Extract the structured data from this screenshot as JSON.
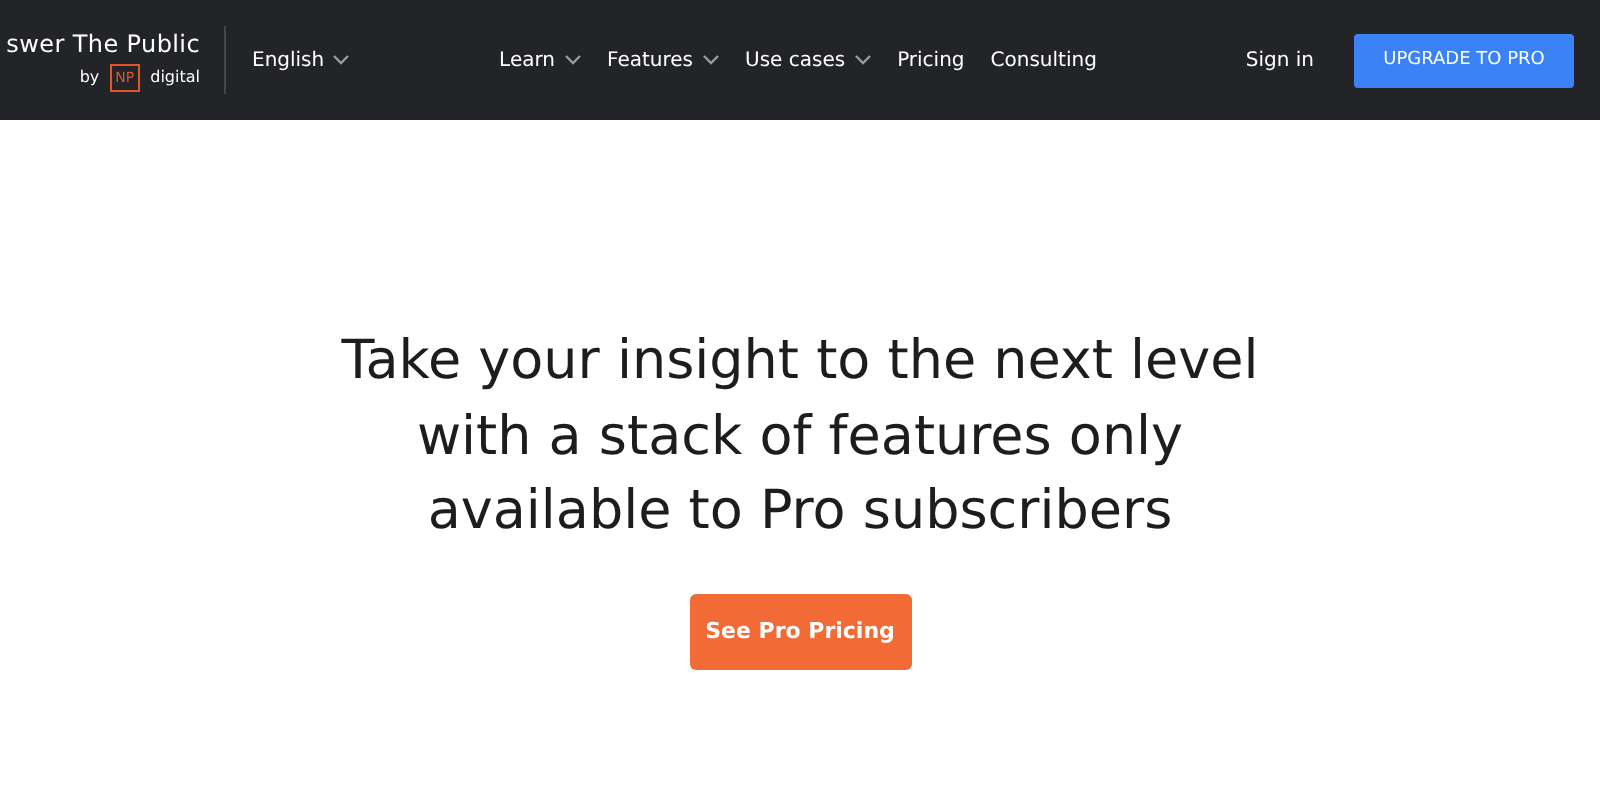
{
  "header": {
    "logo": {
      "title": "swer The Public",
      "by": "by",
      "badge": "NP",
      "brand": "digital"
    },
    "language": {
      "label": "English"
    },
    "nav": [
      {
        "label": "Learn",
        "dropdown": true
      },
      {
        "label": "Features",
        "dropdown": true
      },
      {
        "label": "Use cases",
        "dropdown": true
      },
      {
        "label": "Pricing",
        "dropdown": false
      },
      {
        "label": "Consulting",
        "dropdown": false
      }
    ],
    "sign_in": "Sign in",
    "upgrade": "UPGRADE TO PRO"
  },
  "hero": {
    "headline": [
      "Take your insight to the next level",
      "with a stack of features only",
      "available to Pro subscribers"
    ],
    "cta": "See Pro Pricing"
  }
}
